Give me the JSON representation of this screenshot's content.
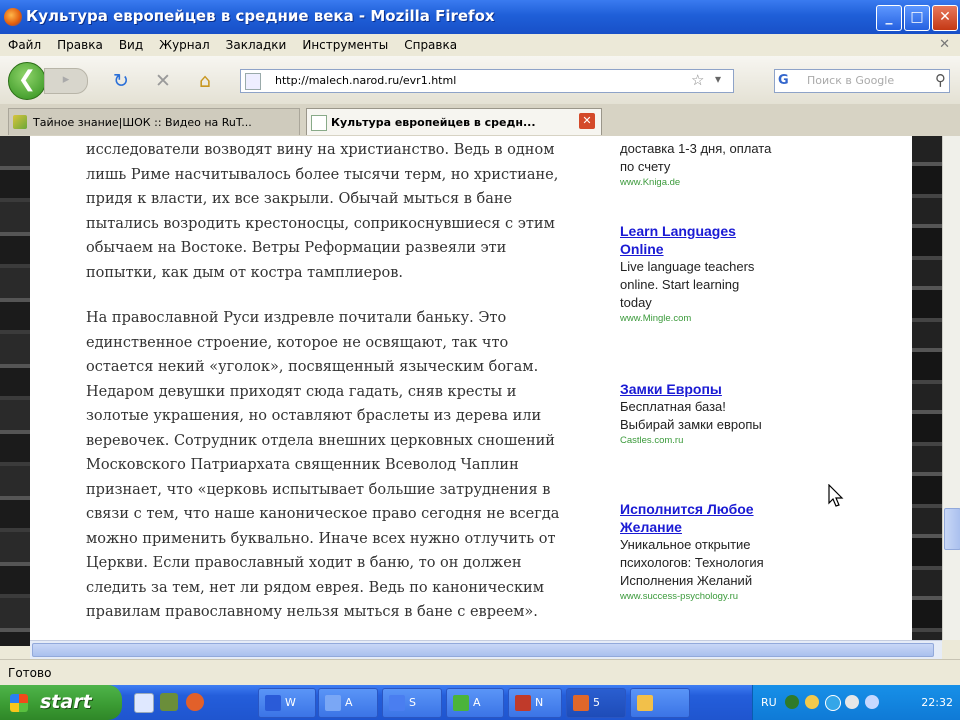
{
  "window": {
    "title": "Культура европейцев в средние века - Mozilla Firefox",
    "controls": {
      "minimize": "_",
      "maximize": "□",
      "close": "✕"
    }
  },
  "menu": [
    "Файл",
    "Правка",
    "Вид",
    "Журнал",
    "Закладки",
    "Инструменты",
    "Справка"
  ],
  "menu_close": "✕",
  "nav": {
    "back_glyph": "❮",
    "forward_glyph": "▸",
    "reload_glyph": "↻",
    "stop_glyph": "✕",
    "home_glyph": "⌂",
    "url": "http://malech.narod.ru/evr1.html",
    "star_glyph": "☆",
    "search_placeholder": "Поиск в Google"
  },
  "tabs": [
    {
      "label": "Тайное знание|ШОК :: Видео на RuT...",
      "active": false
    },
    {
      "label": "Культура европейцев в средн...",
      "active": true,
      "close": "✕"
    }
  ],
  "article": {
    "para1_lines": [
      "исследователи возводят вину на христианство. Ведь в одном",
      "лишь Риме насчитывалось более тысячи терм, но христиане,",
      "придя к власти, их все закрыли. Обычай мыться в бане",
      "пытались возродить крестоносцы, соприкоснувшиеся с этим",
      "обычаем на Востоке. Ветры Реформации развеяли эти",
      "попытки, как дым от костра тамплиеров."
    ],
    "para2_lines": [
      "На православной Руси издревле почитали баньку. Это",
      "единственное строение, которое не освящают, так что",
      "остается некий «уголок», посвященный языческим богам.",
      "Недаром девушки приходят сюда гадать, сняв кресты и",
      "золотые украшения, но оставляют браслеты из дерева или",
      "веревочек. Сотрудник отдела внешних церковных сношений",
      "Московского Патриархата священник Всеволод Чаплин",
      "признает, что «церковь испытывает большие затруднения в",
      "связи с тем, что наше каноническое право сегодня не всегда",
      "можно применить буквально. Иначе всех нужно отлучить от",
      "Церкви. Если православный ходит в баню, то он должен",
      "следить за тем, нет ли рядом еврея. Ведь по каноническим",
      "правилам православному нельзя мыться в бане с евреем»."
    ]
  },
  "ads": [
    {
      "link_lines": [],
      "text_lines": [
        "доставка 1-3 дня, оплата",
        "по счету"
      ],
      "url": "www.Kniga.de"
    },
    {
      "link_lines": [
        "Learn Languages",
        "Online"
      ],
      "text_lines": [
        "Live language teachers",
        "online. Start learning",
        "today"
      ],
      "url": "www.Mingle.com"
    },
    {
      "link_lines": [
        "Замки Европы"
      ],
      "text_lines": [
        "Бесплатная база!",
        "Выбирай замки европы"
      ],
      "url": "Castles.com.ru"
    },
    {
      "link_lines": [
        "Исполнится Любое",
        "Желание"
      ],
      "text_lines": [
        "Уникальное открытие",
        "психологов: Технология",
        "Исполнения Желаний"
      ],
      "url": "www.success-psychology.ru"
    }
  ],
  "status": "Готово",
  "taskbar": {
    "start": "start",
    "buttons": [
      {
        "label": "W",
        "color": "#2a5bd8"
      },
      {
        "label": "A",
        "color": "#7aa7f5"
      },
      {
        "label": "S",
        "color": "#4a7ef0"
      },
      {
        "label": "A",
        "color": "#4bb43a"
      },
      {
        "label": "N",
        "color": "#c03a2a"
      },
      {
        "label": "5",
        "color": "#e0672a"
      },
      {
        "label": "",
        "color": "#f2c04a"
      }
    ],
    "lang": "RU",
    "clock": "22:32"
  }
}
